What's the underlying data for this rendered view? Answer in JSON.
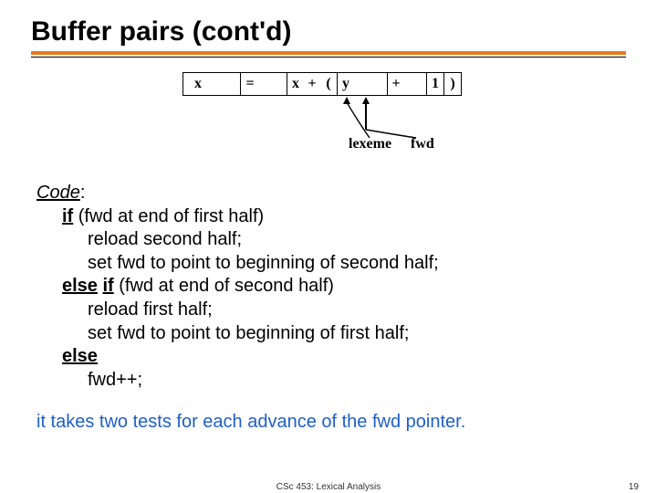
{
  "title": "Buffer pairs (cont'd)",
  "diagram": {
    "cells": [
      "x",
      "=",
      "x",
      "+",
      "(",
      "y",
      "+",
      "1",
      ")"
    ],
    "lexeme_label": "lexeme",
    "fwd_label": "fwd"
  },
  "code": {
    "heading": "Code",
    "lines": [
      {
        "kind": "if1",
        "kw": "if",
        "rest": " (fwd at end of first half)"
      },
      {
        "kind": "body",
        "text": "reload second half;"
      },
      {
        "kind": "body",
        "text": "set fwd to point to beginning of second half;"
      },
      {
        "kind": "elseif",
        "kw1": "else",
        "kw2": "if",
        "rest": " (fwd at end of second half)"
      },
      {
        "kind": "body",
        "text": "reload first half;"
      },
      {
        "kind": "body",
        "text": "set fwd to point to beginning of first half;"
      },
      {
        "kind": "else",
        "kw": "else"
      },
      {
        "kind": "body",
        "text": "fwd++;"
      }
    ]
  },
  "summary": "it takes two tests for each advance of the fwd pointer.",
  "footer": {
    "course": "CSc 453: Lexical Analysis",
    "page": "19"
  }
}
